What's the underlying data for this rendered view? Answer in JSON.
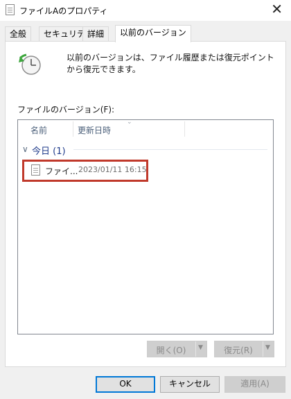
{
  "window": {
    "title": "ファイルAのプロパティ",
    "close_glyph": "✕"
  },
  "tabs": [
    {
      "label": "全般"
    },
    {
      "label": "セキュリティ"
    },
    {
      "label": "詳細"
    },
    {
      "label": "以前のバージョン",
      "active": true
    }
  ],
  "previous_versions": {
    "icon": "restore-clock-icon",
    "description": "以前のバージョンは、ファイル履歴または復元ポイントから復元できます。",
    "versions_label": "ファイルのバージョン(F):",
    "columns": [
      "名前",
      "更新日時"
    ],
    "groups": [
      {
        "title": "今日 (1)",
        "items": [
          {
            "name": "ファイ...",
            "modified": "2023/01/11 16:15",
            "highlighted": true
          }
        ]
      }
    ],
    "open_button": "開く(O)",
    "restore_button": "復元(R)"
  },
  "footer": {
    "ok": "OK",
    "cancel": "キャンセル",
    "apply": "適用(A)"
  },
  "colors": {
    "highlight_border": "#c0392b",
    "ok_border": "#0078d7",
    "group_title": "#1e3a8a"
  }
}
